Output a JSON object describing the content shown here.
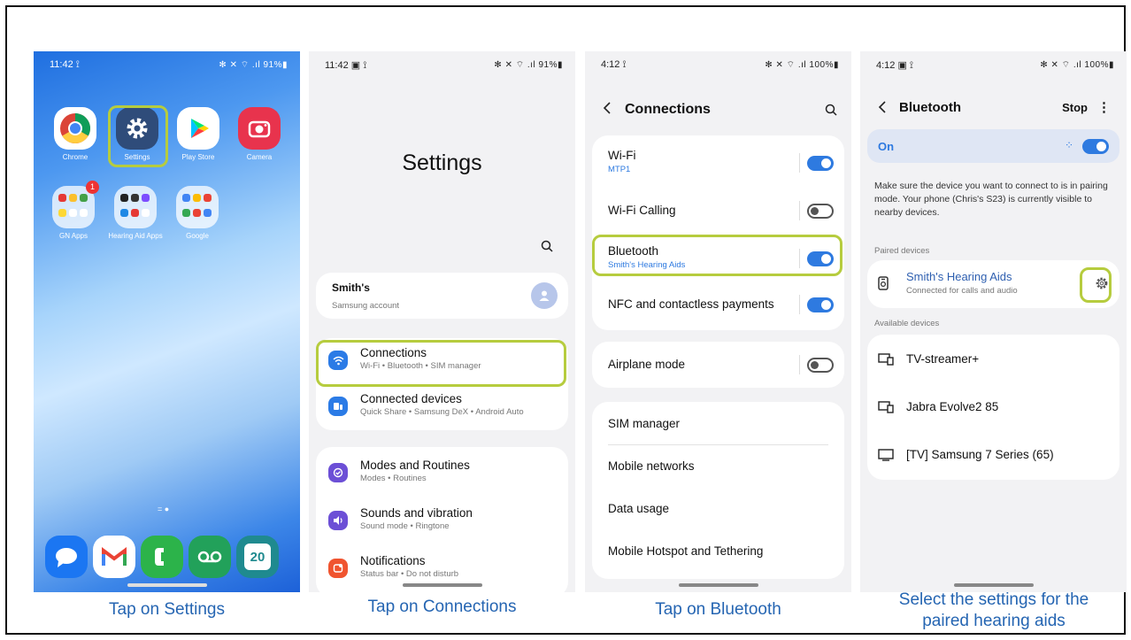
{
  "captions": [
    "Tap on Settings",
    "Tap on Connections",
    "Tap on Bluetooth",
    "Select the settings for the",
    "paired hearing aids"
  ],
  "phone1": {
    "time": "11:42 ⟟",
    "status_right": "✻ ✕ ⌔ .ıl 91%▮",
    "apps": [
      {
        "label": "Chrome",
        "icon": "chrome-icon",
        "color": "#ffffff"
      },
      {
        "label": "Settings",
        "icon": "gear-icon",
        "color": "#2f4c7a"
      },
      {
        "label": "Play Store",
        "icon": "play-store-icon",
        "color": "#ffffff"
      },
      {
        "label": "Camera",
        "icon": "camera-icon",
        "color": "#e8334d"
      }
    ],
    "folders": [
      {
        "label": "GN Apps",
        "badge": "1"
      },
      {
        "label": "Hearing Aid Apps",
        "badge": ""
      },
      {
        "label": "Google",
        "badge": ""
      }
    ],
    "page_dots": "= ●",
    "dock": [
      {
        "icon": "messages-icon",
        "color": "#1b76f2",
        "glyph": "💬"
      },
      {
        "icon": "gmail-icon",
        "color": "#ffffff",
        "glyph": "M"
      },
      {
        "icon": "phone-icon",
        "color": "#2cb34a",
        "glyph": "☎"
      },
      {
        "icon": "voicemail-icon",
        "color": "#22a15a",
        "glyph": "oo"
      },
      {
        "icon": "calendar-icon",
        "color": "#1f8a8f",
        "glyph": "20"
      }
    ]
  },
  "phone2": {
    "time": "11:42 ▣ ⟟",
    "status_right": "✻ ✕ ⌔ .ıl 91%▮",
    "title": "Settings",
    "account_name": "Smith's",
    "account_sub": "Samsung account",
    "items": [
      {
        "title": "Connections",
        "sub": "Wi-Fi  •  Bluetooth  •  SIM manager",
        "color": "#2b7be6",
        "glyph": "≋"
      },
      {
        "title": "Connected devices",
        "sub": "Quick Share  •  Samsung DeX  •  Android Auto",
        "color": "#2b7be6",
        "glyph": "▣"
      },
      {
        "title": "Modes and Routines",
        "sub": "Modes  •  Routines",
        "color": "#6c4fd6",
        "glyph": "✓"
      },
      {
        "title": "Sounds and vibration",
        "sub": "Sound mode  •  Ringtone",
        "color": "#6c4fd6",
        "glyph": "◀"
      },
      {
        "title": "Notifications",
        "sub": "Status bar  •  Do not disturb",
        "color": "#f0542f",
        "glyph": "▪"
      }
    ]
  },
  "phone3": {
    "time": "4:12 ⟟",
    "status_right": "✻ ✕ ⌔ .ıl 100%▮",
    "title": "Connections",
    "rows": [
      {
        "title": "Wi-Fi",
        "sub": "MTP1",
        "toggle": "on"
      },
      {
        "title": "Wi-Fi Calling",
        "sub": "",
        "toggle": "off"
      },
      {
        "title": "Bluetooth",
        "sub": "Smith's Hearing Aids",
        "toggle": "on"
      },
      {
        "title": "NFC and contactless payments",
        "sub": "",
        "toggle": "on"
      },
      {
        "title": "Airplane mode",
        "sub": "",
        "toggle": "off"
      },
      {
        "title": "SIM manager"
      },
      {
        "title": "Mobile networks"
      },
      {
        "title": "Data usage"
      },
      {
        "title": "Mobile Hotspot and Tethering"
      }
    ]
  },
  "phone4": {
    "time": "4:12 ▣ ⟟",
    "status_right": "✻ ✕ ⌔ .ıl 100%▮",
    "title": "Bluetooth",
    "stop_label": "Stop",
    "on_label": "On",
    "description": "Make sure the device you want to connect to is in pairing mode. Your phone (Chris's S23) is currently visible to nearby devices.",
    "paired_header": "Paired devices",
    "paired_name": "Smith's Hearing Aids",
    "paired_sub": "Connected for calls and audio",
    "available_header": "Available devices",
    "available": [
      "TV-streamer+",
      "Jabra Evolve2 85",
      "[TV] Samsung 7 Series (65)"
    ]
  }
}
